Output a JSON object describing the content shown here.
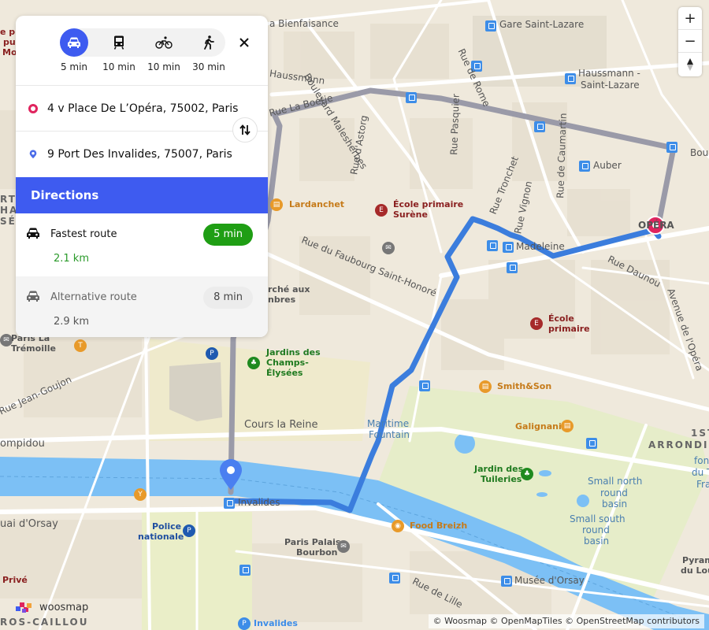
{
  "panel": {
    "modes": [
      {
        "name": "car",
        "time": "5 min",
        "active": true
      },
      {
        "name": "transit",
        "time": "10 min",
        "active": false
      },
      {
        "name": "bike",
        "time": "10 min",
        "active": false
      },
      {
        "name": "walk",
        "time": "30 min",
        "active": false
      }
    ],
    "origin": "4 v Place De L’Opéra, 75002, Paris",
    "destination": "9 Port Des Invalides, 75007, Paris",
    "directions_title": "Directions",
    "routes": [
      {
        "name": "Fastest route",
        "duration": "5 min",
        "distance": "2.1 km",
        "selected": true
      },
      {
        "name": "Alternative route",
        "duration": "8 min",
        "distance": "2.9 km",
        "selected": false
      }
    ]
  },
  "map": {
    "zoom_in": "+",
    "zoom_out": "−",
    "attribution": "© Woosmap © OpenMapTiles © OpenStreetMap contributors",
    "logo_text": "woosmap",
    "colors": {
      "route_main": "#3b7ddd",
      "route_alt": "#9a9aa8",
      "origin_pin": "#e0245e",
      "dest_pin": "#4a7ff0",
      "water": "#7cc0f5",
      "park": "#e6edc9"
    },
    "labels": {
      "bienfaisance": "a Bienfaisance",
      "gare_st_lazare": "Gare Saint-Lazare",
      "haussmann": "Haussmann",
      "haussmann_stlazare_1": "Haussmann -",
      "haussmann_stlazare_2": "Saint-Lazare",
      "boulevard_malesherbes": "Boulevard Malesherbes",
      "rue_de_rome": "Rue de Rome",
      "rue_la_boetie": "Rue La Boétie",
      "rue_dastorg": "Rue d'Astorg",
      "rue_pasquier": "Rue Pasquier",
      "rue_caumartin": "Rue de Caumartin",
      "rue_tronchet": "Rue Tronchet",
      "rue_vignon": "Rue Vignon",
      "auber": "Auber",
      "bou": "Bou",
      "lardanchet": "Lardanchet",
      "ecole_surene_1": "École primaire",
      "ecole_surene_2": "Surène",
      "opera": "OPÉRA",
      "madeleine": "Madeleine",
      "rue_faubourg": "Rue du Faubourg Saint-Honoré",
      "rue_daunou": "Rue Daunou",
      "avenue_opera": "Avenue de l'Opéra",
      "marche_1": "rché aux",
      "marche_2": "nbres",
      "ecole_primaire_1": "École",
      "ecole_primaire_2": "primaire",
      "paris_tremoille_1": "Paris La",
      "paris_tremoille_2": "Trémoille",
      "jardins_champs_1": "Jardins des",
      "jardins_champs_2": "Champs-",
      "jardins_champs_3": "Élysées",
      "smith_son": "Smith&Son",
      "rue_jean_goujon": "Rue Jean-Goujon",
      "maritime_1": "Maritime",
      "maritime_2": "Fountain",
      "galignani": "Galignani",
      "arrond_1": "1ST",
      "arrond_2": "ARRONDIS",
      "fon_1": "fon",
      "fon_2": "du T",
      "fon_3": "Fra",
      "cours_la_reine": "Cours la Reine",
      "pompidou": "ompidou",
      "jardin_tuileries_1": "Jardin des",
      "jardin_tuileries_2": "Tuileries",
      "small_north_1": "Small north",
      "small_north_2": "round",
      "small_north_3": "basin",
      "small_south_1": "Small south",
      "small_south_2": "round",
      "small_south_3": "basin",
      "invalides_stop": "Invalides",
      "quai_orsay": "uai d'Orsay",
      "police_1": "Police",
      "police_2": "nationale",
      "food_breizh": "Food Breizh",
      "palais_bourbon_1": "Paris Palais",
      "palais_bourbon_2": "Bourbon",
      "pyramide_1": "Pyram",
      "pyramide_2": "du Lou",
      "prive": "Privé",
      "rue_de_lille": "Rue de Lille",
      "musee_orsay": "Musée d'Orsay",
      "gros_caillou": "ROS-CAILLOU",
      "invalides_parking": "Invalides",
      "ecole_left_1": "e pri",
      "ecole_left_2": "pul",
      "ecole_left_3": "Mo",
      "arti_1": "RTI",
      "arti_2": "HAM",
      "arti_3": "SÉE"
    }
  }
}
